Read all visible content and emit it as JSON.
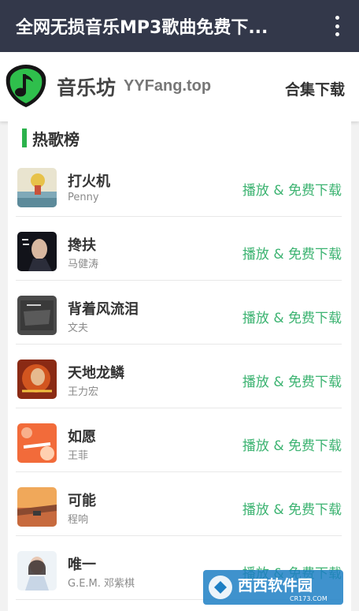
{
  "appbar": {
    "title": "全网无损音乐MP3歌曲免费下..."
  },
  "header": {
    "brand_cn": "音乐坊",
    "brand_en": "YYFang.top",
    "collection_link": "合集下载"
  },
  "section": {
    "title": "热歌榜"
  },
  "songs": [
    {
      "title": "打火机",
      "artist": "Penny",
      "action": "播放 & 免费下载"
    },
    {
      "title": "搀扶",
      "artist": "马健涛",
      "action": "播放 & 免费下载"
    },
    {
      "title": "背着风流泪",
      "artist": "文夫",
      "action": "播放 & 免费下载"
    },
    {
      "title": "天地龙鳞",
      "artist": "王力宏",
      "action": "播放 & 免费下载"
    },
    {
      "title": "如愿",
      "artist": "王菲",
      "action": "播放 & 免费下载"
    },
    {
      "title": "可能",
      "artist": "程响",
      "action": "播放 & 免费下载"
    },
    {
      "title": "唯一",
      "artist": "G.E.M. 邓紫棋",
      "action": "播放 & 免费下载"
    }
  ],
  "watermark": {
    "text": "西西软件园",
    "sub": "CR173.COM"
  },
  "colors": {
    "appbar_bg": "#33384a",
    "accent_green": "#2bb24c",
    "action_green": "#3cb371"
  },
  "icons": {
    "menu": "more-vertical-icon",
    "logo": "music-note-shield-icon"
  }
}
